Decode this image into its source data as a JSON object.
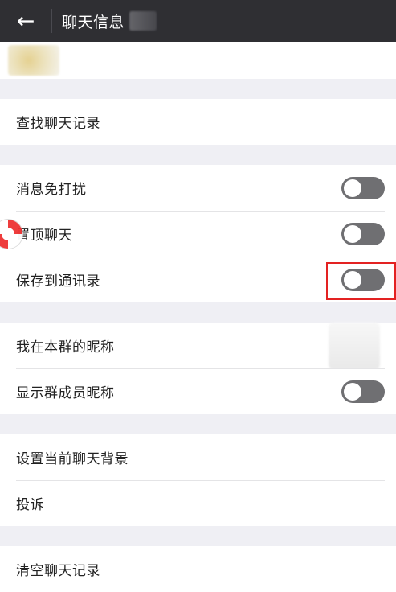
{
  "header": {
    "back_icon": "arrow-left-icon",
    "title": "聊天信息"
  },
  "sections": {
    "search_history": "查找聊天记录",
    "mute": "消息免打扰",
    "sticky": "置顶聊天",
    "save_contacts": "保存到通讯录",
    "my_nickname": "我在本群的昵称",
    "show_member_nicknames": "显示群成员昵称",
    "set_background": "设置当前聊天背景",
    "complain": "投诉",
    "clear_history": "清空聊天记录"
  },
  "toggles": {
    "mute": "off",
    "sticky": "off",
    "save_contacts": "off",
    "show_member_nicknames": "off"
  },
  "colors": {
    "topbar": "#2f2f33",
    "background": "#efeff4",
    "row": "#ffffff",
    "toggle_off": "#6f6f72",
    "highlight": "#e32222"
  }
}
